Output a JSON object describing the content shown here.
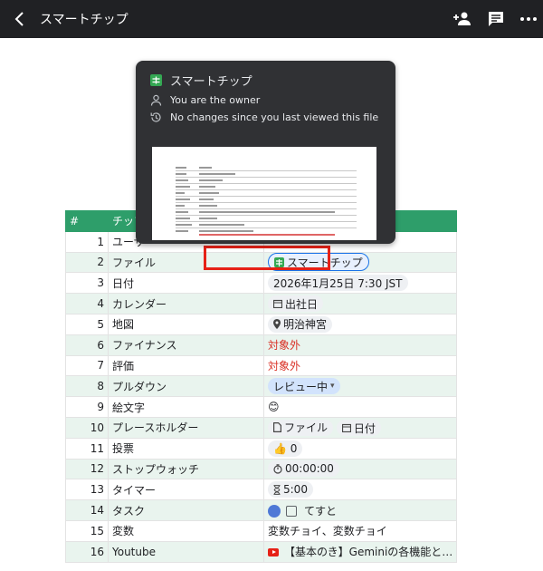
{
  "appbar": {
    "title": "スマートチップ"
  },
  "popup": {
    "title": "スマートチップ",
    "owner": "You are the owner",
    "changes": "No changes since you last viewed this file"
  },
  "table": {
    "header": {
      "num": "#",
      "name": "チップ"
    },
    "rows": [
      {
        "num": "1",
        "name": "ユーザー",
        "value": ""
      },
      {
        "num": "2",
        "name": "ファイル",
        "value": "スマートチップ"
      },
      {
        "num": "3",
        "name": "日付",
        "value": "2026年1月25日 7:30 JST"
      },
      {
        "num": "4",
        "name": "カレンダー",
        "value": "出社日"
      },
      {
        "num": "5",
        "name": "地図",
        "value": "明治神宮"
      },
      {
        "num": "6",
        "name": "ファイナンス",
        "value": "対象外"
      },
      {
        "num": "7",
        "name": "評価",
        "value": "対象外"
      },
      {
        "num": "8",
        "name": "プルダウン",
        "value": "レビュー中"
      },
      {
        "num": "9",
        "name": "絵文字",
        "value": "😊"
      },
      {
        "num": "10",
        "name": "プレースホルダー",
        "value": "ファイル",
        "value2": "日付"
      },
      {
        "num": "11",
        "name": "投票",
        "value": "👍 0"
      },
      {
        "num": "12",
        "name": "ストップウォッチ",
        "value": "00:00:00"
      },
      {
        "num": "13",
        "name": "タイマー",
        "value": "5:00"
      },
      {
        "num": "14",
        "name": "タスク",
        "value": "てすと"
      },
      {
        "num": "15",
        "name": "変数",
        "value": "変数チョイ、変数チョイ"
      },
      {
        "num": "16",
        "name": "Youtube",
        "value": "【基本のき】Geminiの各機能と…"
      }
    ]
  },
  "colors": {
    "header_green": "#2e9e6a",
    "highlight_red": "#e62117",
    "appbar": "#202124"
  }
}
